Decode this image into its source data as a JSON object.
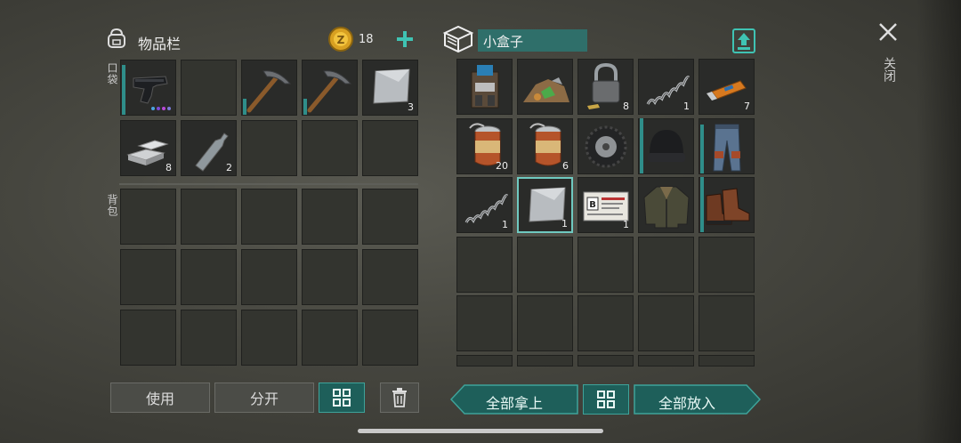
{
  "inventory": {
    "title": "物品栏",
    "coins": "18",
    "pocket_label": "口袋",
    "backpack_label": "背包",
    "pocket_items": [
      {
        "name": "pistol",
        "count": ""
      },
      {
        "name": "empty",
        "count": ""
      },
      {
        "name": "pickaxe",
        "count": ""
      },
      {
        "name": "pickaxe",
        "count": ""
      },
      {
        "name": "metal-plate",
        "count": "3"
      },
      {
        "name": "silver-bars",
        "count": "8"
      },
      {
        "name": "water-bottle",
        "count": "2"
      }
    ]
  },
  "container": {
    "title": "小盒子",
    "items": [
      {
        "name": "workbench-device",
        "count": ""
      },
      {
        "name": "scrap-pile",
        "count": ""
      },
      {
        "name": "padlock",
        "count": "8"
      },
      {
        "name": "spring",
        "count": "1"
      },
      {
        "name": "usb-drive",
        "count": "7"
      },
      {
        "name": "canned-food",
        "count": "20"
      },
      {
        "name": "canned-food",
        "count": "6"
      },
      {
        "name": "tire",
        "count": ""
      },
      {
        "name": "beanie-hat",
        "count": ""
      },
      {
        "name": "jeans",
        "count": ""
      },
      {
        "name": "spring",
        "count": "1"
      },
      {
        "name": "metal-plate",
        "count": "1"
      },
      {
        "name": "army-id-card",
        "count": "1"
      },
      {
        "name": "leather-jacket",
        "count": ""
      },
      {
        "name": "boots",
        "count": ""
      }
    ]
  },
  "buttons": {
    "use": "使用",
    "split": "分开",
    "take_all": "全部拿上",
    "put_all": "全部放入",
    "close": "关闭"
  }
}
